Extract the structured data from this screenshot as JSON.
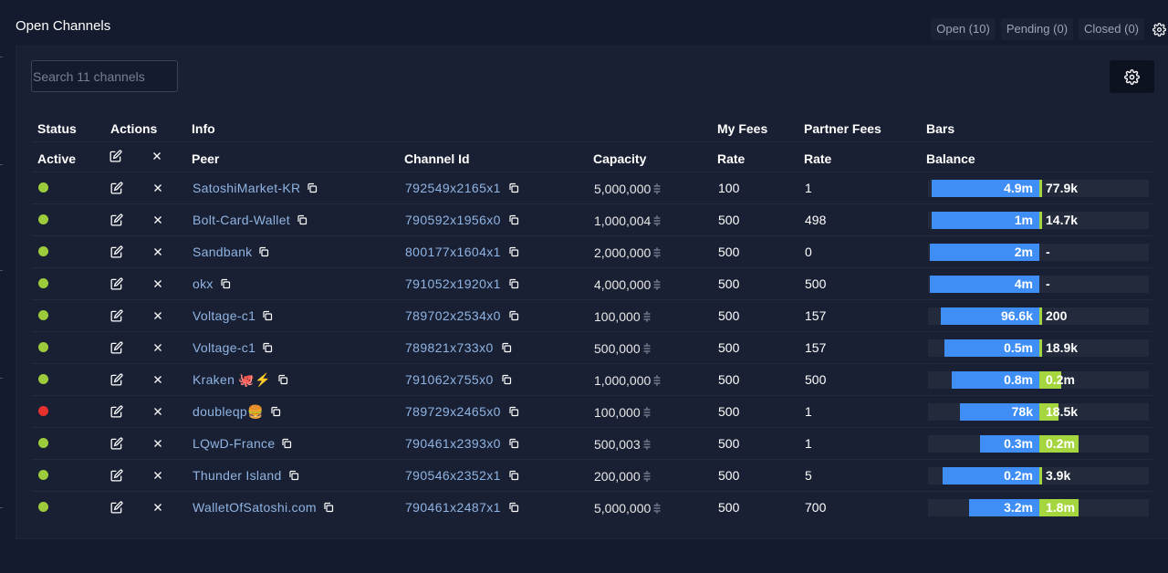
{
  "page": {
    "title": "Open Channels"
  },
  "tabs": [
    {
      "label": "Open (10)"
    },
    {
      "label": "Pending (0)"
    },
    {
      "label": "Closed (0)"
    }
  ],
  "search": {
    "placeholder": "Search 11 channels",
    "value": ""
  },
  "table": {
    "group_headers": {
      "status": "Status",
      "actions": "Actions",
      "info": "Info",
      "my_fees": "My Fees",
      "partner_fees": "Partner Fees",
      "bars": "Bars"
    },
    "columns": {
      "active": "Active",
      "peer": "Peer",
      "channel_id": "Channel Id",
      "capacity": "Capacity",
      "my_rate": "Rate",
      "partner_rate": "Rate",
      "balance": "Balance"
    },
    "status_colors": {
      "active": "#9ccc3c",
      "inactive": "#e5322d"
    },
    "rows": [
      {
        "active": true,
        "peer": "SatoshiMarket-KR",
        "channel_id": "792549x2165x1",
        "capacity": "5,000,000",
        "my_rate": "100",
        "partner_rate": "1",
        "local_label": "4.9m",
        "remote_label": "77.9k",
        "local": 4900000,
        "remote": 77900
      },
      {
        "active": true,
        "peer": "Bolt-Card-Wallet",
        "channel_id": "790592x1956x0",
        "capacity": "1,000,004",
        "my_rate": "500",
        "partner_rate": "498",
        "local_label": "1m",
        "remote_label": "14.7k",
        "local": 1000000,
        "remote": 14700
      },
      {
        "active": true,
        "peer": "Sandbank",
        "channel_id": "800177x1604x1",
        "capacity": "2,000,000",
        "my_rate": "500",
        "partner_rate": "0",
        "local_label": "2m",
        "remote_label": "-",
        "local": 2000000,
        "remote": 0
      },
      {
        "active": true,
        "peer": "okx",
        "channel_id": "791052x1920x1",
        "capacity": "4,000,000",
        "my_rate": "500",
        "partner_rate": "500",
        "local_label": "4m",
        "remote_label": "-",
        "local": 4000000,
        "remote": 0
      },
      {
        "active": true,
        "peer": "Voltage-c1",
        "channel_id": "789702x2534x0",
        "capacity": "100,000",
        "my_rate": "500",
        "partner_rate": "157",
        "local_label": "96.6k",
        "remote_label": "200",
        "local": 96600,
        "remote": 200
      },
      {
        "active": true,
        "peer": "Voltage-c1",
        "channel_id": "789821x733x0",
        "capacity": "500,000",
        "my_rate": "500",
        "partner_rate": "157",
        "local_label": "0.5m",
        "remote_label": "18.9k",
        "local": 480000,
        "remote": 18900
      },
      {
        "active": true,
        "peer": "Kraken 🐙⚡",
        "channel_id": "791062x755x0",
        "capacity": "1,000,000",
        "my_rate": "500",
        "partner_rate": "500",
        "local_label": "0.8m",
        "remote_label": "0.2m",
        "local": 800000,
        "remote": 200000
      },
      {
        "active": false,
        "peer": "doubleqp🍔",
        "channel_id": "789729x2465x0",
        "capacity": "100,000",
        "my_rate": "500",
        "partner_rate": "1",
        "local_label": "78k",
        "remote_label": "18.5k",
        "local": 78000,
        "remote": 18500
      },
      {
        "active": true,
        "peer": "LQwD-France",
        "channel_id": "790461x2393x0",
        "capacity": "500,003",
        "my_rate": "500",
        "partner_rate": "1",
        "local_label": "0.3m",
        "remote_label": "0.2m",
        "local": 300000,
        "remote": 200000
      },
      {
        "active": true,
        "peer": "Thunder Island",
        "channel_id": "790546x2352x1",
        "capacity": "200,000",
        "my_rate": "500",
        "partner_rate": "5",
        "local_label": "0.2m",
        "remote_label": "3.9k",
        "local": 196000,
        "remote": 3900
      },
      {
        "active": true,
        "peer": "WalletOfSatoshi.com",
        "channel_id": "790461x2487x1",
        "capacity": "5,000,000",
        "my_rate": "500",
        "partner_rate": "700",
        "local_label": "3.2m",
        "remote_label": "1.8m",
        "local": 3200000,
        "remote": 1800000
      }
    ]
  },
  "colors": {
    "local_bar": "#3f8ef5",
    "remote_bar": "#a6d63f"
  },
  "icons": {
    "edit": "edit-icon",
    "close": "close-icon",
    "copy": "copy-icon",
    "settings": "gear-icon",
    "sats": "sats-icon"
  }
}
